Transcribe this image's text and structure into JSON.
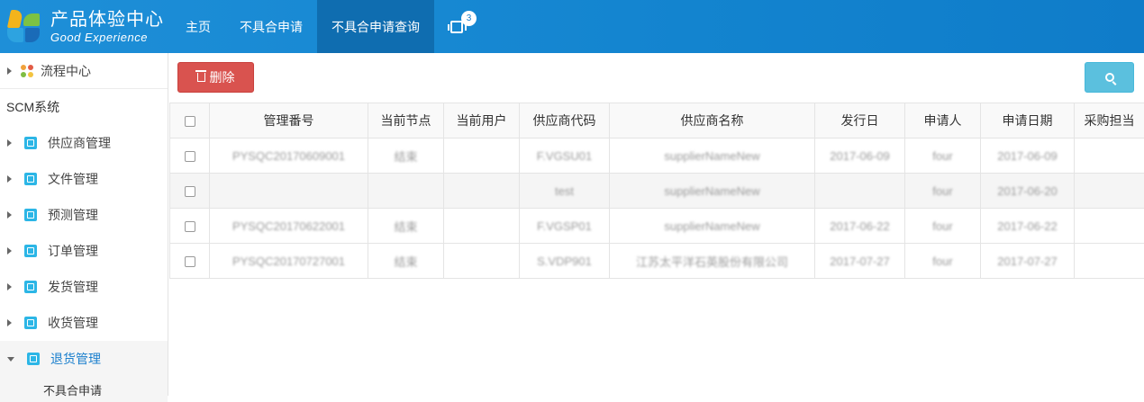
{
  "brand": {
    "title": "产品体验中心",
    "subtitle": "Good Experience"
  },
  "nav": {
    "items": [
      {
        "label": "主页"
      },
      {
        "label": "不具合申请"
      },
      {
        "label": "不具合申请查询"
      }
    ],
    "messages_count": "3"
  },
  "sidebar": {
    "flow_center": "流程中心",
    "section_title": "SCM系统",
    "items": [
      {
        "label": "供应商管理"
      },
      {
        "label": "文件管理"
      },
      {
        "label": "预测管理"
      },
      {
        "label": "订单管理"
      },
      {
        "label": "发货管理"
      },
      {
        "label": "收货管理"
      },
      {
        "label": "退货管理"
      }
    ],
    "sub_item": "不具合申请"
  },
  "toolbar": {
    "delete_label": "删除"
  },
  "table": {
    "headers": [
      "管理番号",
      "当前节点",
      "当前用户",
      "供应商代码",
      "供应商名称",
      "发行日",
      "申请人",
      "申请日期",
      "采购担当"
    ],
    "rows": [
      [
        "PYSQC20170609001",
        "结束",
        "",
        "F.VGSU01",
        "supplierNameNew",
        "2017-06-09",
        "four",
        "2017-06-09",
        ""
      ],
      [
        "",
        "",
        "",
        "test",
        "supplierNameNew",
        "",
        "four",
        "2017-06-20",
        ""
      ],
      [
        "PYSQC20170622001",
        "结束",
        "",
        "F.VGSP01",
        "supplierNameNew",
        "2017-06-22",
        "four",
        "2017-06-22",
        ""
      ],
      [
        "PYSQC20170727001",
        "结束",
        "",
        "S.VDP901",
        "江苏太平洋石英股份有限公司",
        "2017-07-27",
        "four",
        "2017-07-27",
        ""
      ]
    ]
  },
  "colors": {
    "header_blue": "#1384cf",
    "delete_red": "#d9534f",
    "search_cyan": "#5bc0de",
    "active_link": "#1a7fcd"
  }
}
